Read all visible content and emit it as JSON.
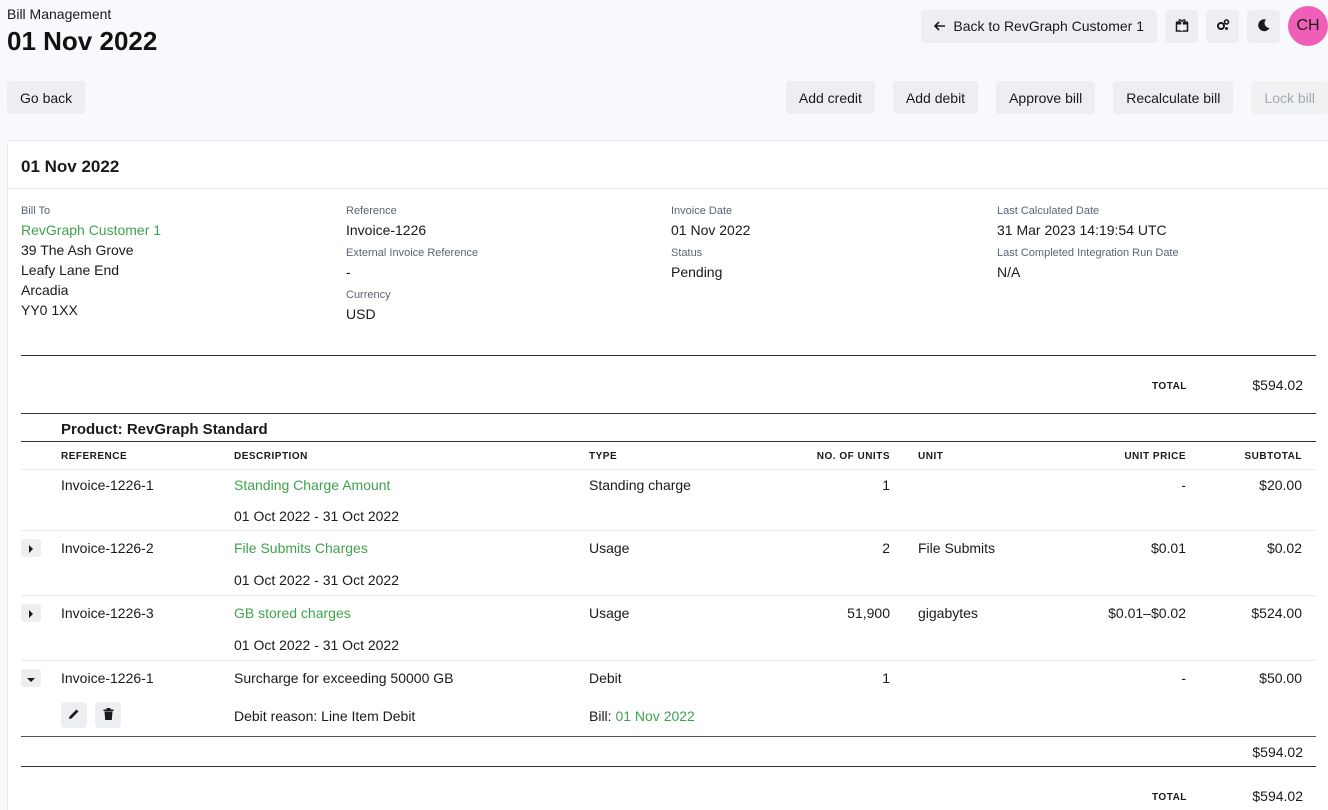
{
  "header": {
    "app_label": "Bill Management",
    "title": "01 Nov 2022",
    "back_label": "Back to RevGraph Customer 1",
    "avatar_initials": "CH"
  },
  "toolbar": {
    "go_back": "Go back",
    "add_credit": "Add credit",
    "add_debit": "Add debit",
    "approve_bill": "Approve bill",
    "recalculate_bill": "Recalculate bill",
    "lock_bill": "Lock bill"
  },
  "bill": {
    "title": "01 Nov 2022",
    "bill_to_label": "Bill To",
    "customer_name": "RevGraph Customer 1",
    "address": [
      "39 The Ash Grove",
      "Leafy Lane End",
      "Arcadia",
      "YY0 1XX"
    ],
    "reference_label": "Reference",
    "reference": "Invoice-1226",
    "external_ref_label": "External Invoice Reference",
    "external_ref": "-",
    "currency_label": "Currency",
    "currency": "USD",
    "invoice_date_label": "Invoice Date",
    "invoice_date": "01 Nov 2022",
    "status_label": "Status",
    "status": "Pending",
    "last_calc_label": "Last Calculated Date",
    "last_calc": "31 Mar 2023 14:19:54 UTC",
    "last_run_label": "Last Completed Integration Run Date",
    "last_run": "N/A",
    "total_label": "TOTAL",
    "total": "$594.02"
  },
  "product": {
    "title": "Product: RevGraph Standard",
    "columns": {
      "reference": "REFERENCE",
      "description": "DESCRIPTION",
      "type": "TYPE",
      "units": "NO. OF UNITS",
      "unit": "UNIT",
      "unit_price": "UNIT PRICE",
      "subtotal": "SUBTOTAL"
    },
    "rows": [
      {
        "reference": "Invoice-1226-1",
        "description": "Standing Charge Amount",
        "period": "01 Oct 2022 - 31 Oct 2022",
        "type": "Standing charge",
        "units": "1",
        "unit": "",
        "unit_price": "-",
        "subtotal": "$20.00"
      },
      {
        "reference": "Invoice-1226-2",
        "description": "File Submits Charges",
        "period": "01 Oct 2022 - 31 Oct 2022",
        "type": "Usage",
        "units": "2",
        "unit": "File Submits",
        "unit_price": "$0.01",
        "subtotal": "$0.02"
      },
      {
        "reference": "Invoice-1226-3",
        "description": "GB stored charges",
        "period": "01 Oct 2022 - 31 Oct 2022",
        "type": "Usage",
        "units": "51,900",
        "unit": "gigabytes",
        "unit_price": "$0.01–$0.02",
        "subtotal": "$524.00"
      },
      {
        "reference": "Invoice-1226-1",
        "description": "Surcharge for exceeding 50000 GB",
        "debit_reason": "Debit reason: Line Item Debit",
        "type": "Debit",
        "bill_label": "Bill: ",
        "bill_link": "01 Nov 2022",
        "units": "1",
        "unit": "",
        "unit_price": "-",
        "subtotal": "$50.00"
      }
    ],
    "product_subtotal": "$594.02",
    "grand_total_label": "TOTAL",
    "grand_total": "$594.02"
  }
}
